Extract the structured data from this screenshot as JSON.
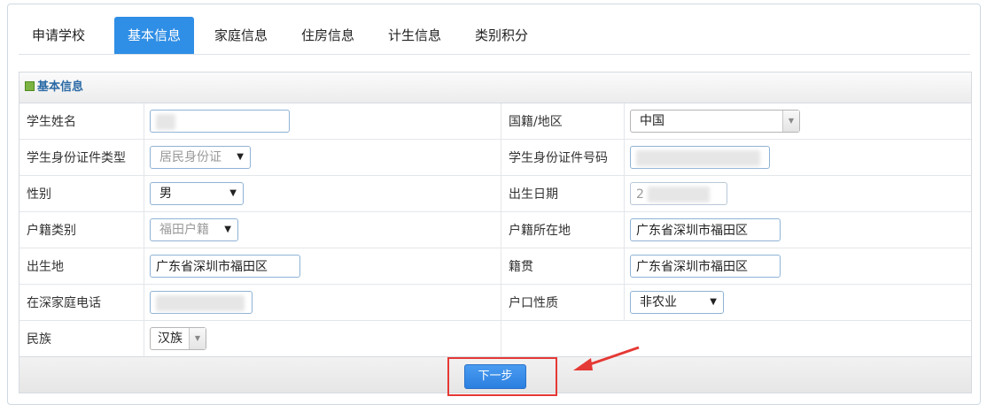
{
  "tabs": [
    {
      "label": "申请学校",
      "active": false
    },
    {
      "label": "基本信息",
      "active": true
    },
    {
      "label": "家庭信息",
      "active": false
    },
    {
      "label": "住房信息",
      "active": false
    },
    {
      "label": "计生信息",
      "active": false
    },
    {
      "label": "类别积分",
      "active": false
    }
  ],
  "panel": {
    "title": "基本信息",
    "rows": [
      {
        "left_label": "学生姓名",
        "right_label": "国籍/地区"
      },
      {
        "left_label": "学生身份证件类型",
        "right_label": "学生身份证件号码"
      },
      {
        "left_label": "性别",
        "right_label": "出生日期"
      },
      {
        "left_label": "户籍类别",
        "right_label": "户籍所在地"
      },
      {
        "left_label": "出生地",
        "right_label": "籍贯"
      },
      {
        "left_label": "在深家庭电话",
        "right_label": "户口性质"
      },
      {
        "left_label": "民族",
        "right_label": ""
      }
    ],
    "fields": {
      "nationality": "中国",
      "id_type": "居民身份证",
      "gender": "男",
      "birth_date_prefix": "2",
      "household_type": "福田户籍",
      "household_location": "广东省深圳市福田区",
      "birthplace": "广东省深圳市福田区",
      "native_place": "广东省深圳市福田区",
      "hukou_nature": "非农业",
      "ethnicity": "汉族"
    }
  },
  "footer": {
    "next_label": "下一步"
  },
  "colors": {
    "accent": "#2f8ee5",
    "highlight": "#e53935",
    "label_blue": "#2b6aa6"
  }
}
